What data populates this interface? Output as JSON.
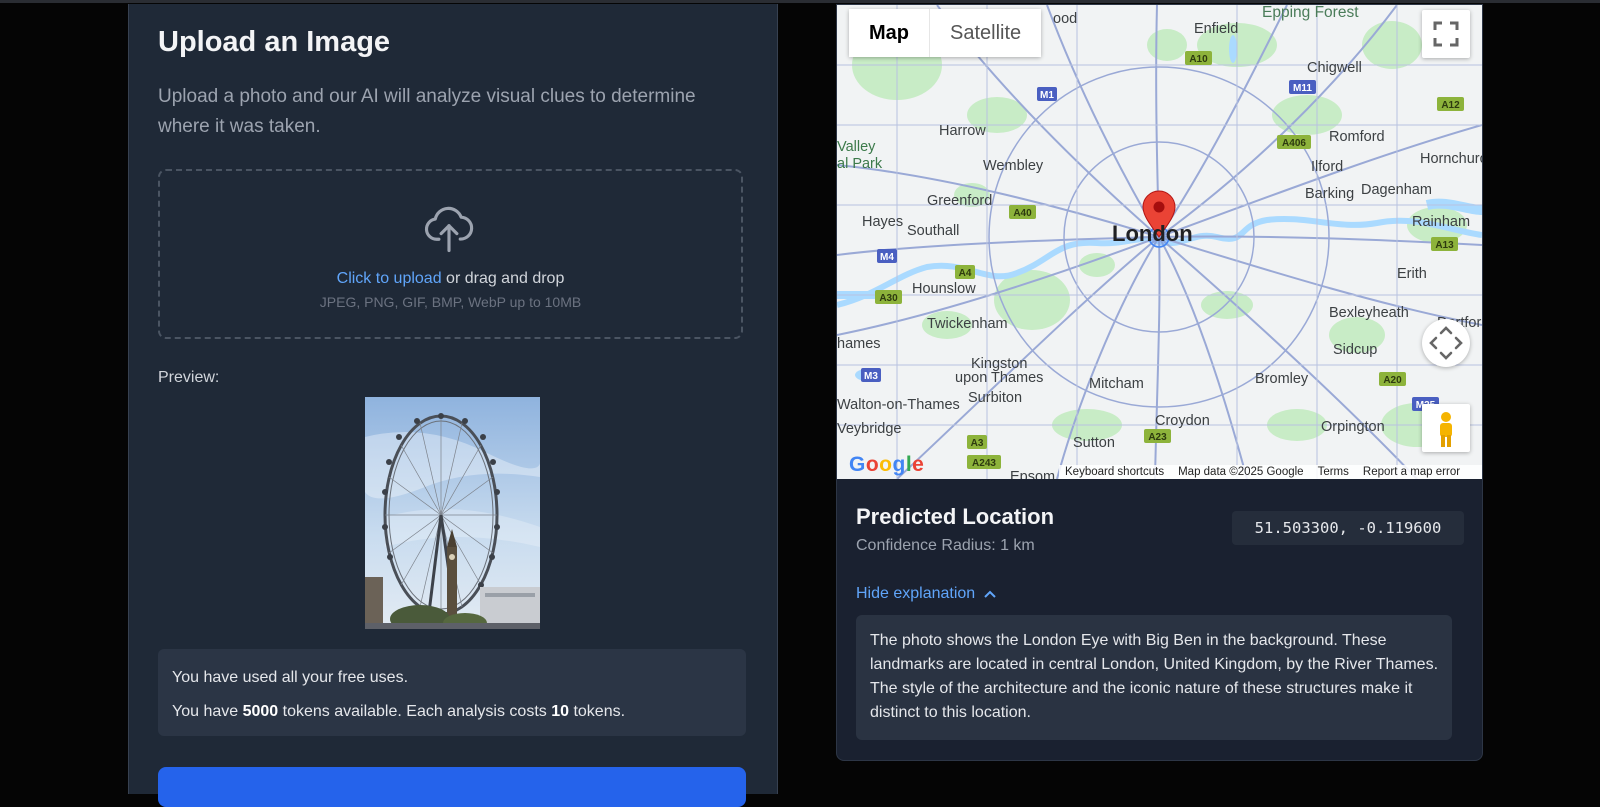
{
  "upload": {
    "title": "Upload an Image",
    "description": "Upload a photo and our AI will analyze visual clues to determine where it was taken.",
    "dropzone": {
      "link_text": "Click to upload",
      "rest_text": " or drag and drop",
      "hint": "JPEG, PNG, GIF, BMP, WebP up to 10MB",
      "icon": "cloud-upload-icon"
    },
    "preview_label": "Preview:",
    "usage": {
      "free_uses_text": "You have used all your free uses.",
      "tokens_prefix": "You have ",
      "tokens_available": "5000",
      "tokens_middle": " tokens available. Each analysis costs ",
      "cost_per_analysis": "10",
      "tokens_suffix": " tokens."
    }
  },
  "map": {
    "type_buttons": [
      "Map",
      "Satellite"
    ],
    "active_type": "Map",
    "place_labels": {
      "london": "London",
      "enfield": "Enfield",
      "epping_forest": "Epping Forest",
      "chigwell": "Chigwell",
      "harrow": "Harrow",
      "romford": "Romford",
      "hornchurch": "Hornchurch",
      "valley": "Valley",
      "park": "al Park",
      "wembley": "Wembley",
      "ilford": "Ilford",
      "greenford": "Greenford",
      "barking": "Barking",
      "dagenham": "Dagenham",
      "hayes": "Hayes",
      "southall": "Southall",
      "rainham": "Rainham",
      "erith": "Erith",
      "hounslow": "Hounslow",
      "bexleyheath": "Bexleyheath",
      "dartford": "Dartford",
      "twickenham": "Twickenham",
      "thames": "hames",
      "sidcup": "Sidcup",
      "kingston": "Kingston",
      "upon_thames": "upon Thames",
      "surbiton": "Surbiton",
      "mitcham": "Mitcham",
      "bromley": "Bromley",
      "walton": "Walton-on-Thames",
      "weybridge": "Veybridge",
      "croydon": "Croydon",
      "orpington": "Orpington",
      "sutton": "Sutton",
      "epsom": "Epsom",
      "wood": "ood"
    },
    "road_labels": [
      "A10",
      "M11",
      "M1",
      "A12",
      "A406",
      "A40",
      "M4",
      "A4",
      "A30",
      "A13",
      "M3",
      "A20",
      "A3",
      "A23",
      "A243",
      "M25"
    ],
    "footer": {
      "keyboard_shortcuts": "Keyboard shortcuts",
      "map_data": "Map data ©2025 Google",
      "terms": "Terms",
      "report": "Report a map error"
    },
    "google_logo": "Google",
    "colors": {
      "water": "#aadaff",
      "park": "#c8ecc6",
      "road": "#9aa9d6",
      "marker": "#ea4335",
      "land": "#f1f3f4"
    }
  },
  "result": {
    "title": "Predicted Location",
    "confidence": "Confidence Radius: 1 km",
    "coordinates": "51.503300, -0.119600",
    "toggle_label": "Hide explanation",
    "explanation": "The photo shows the London Eye with Big Ben in the background. These landmarks are located in central London, United Kingdom, by the River Thames. The style of the architecture and the iconic nature of these structures make it distinct to this location."
  },
  "colors": {
    "panel": "#1f2937",
    "accent": "#60a5fa",
    "button": "#2563eb",
    "background": "#050505"
  }
}
